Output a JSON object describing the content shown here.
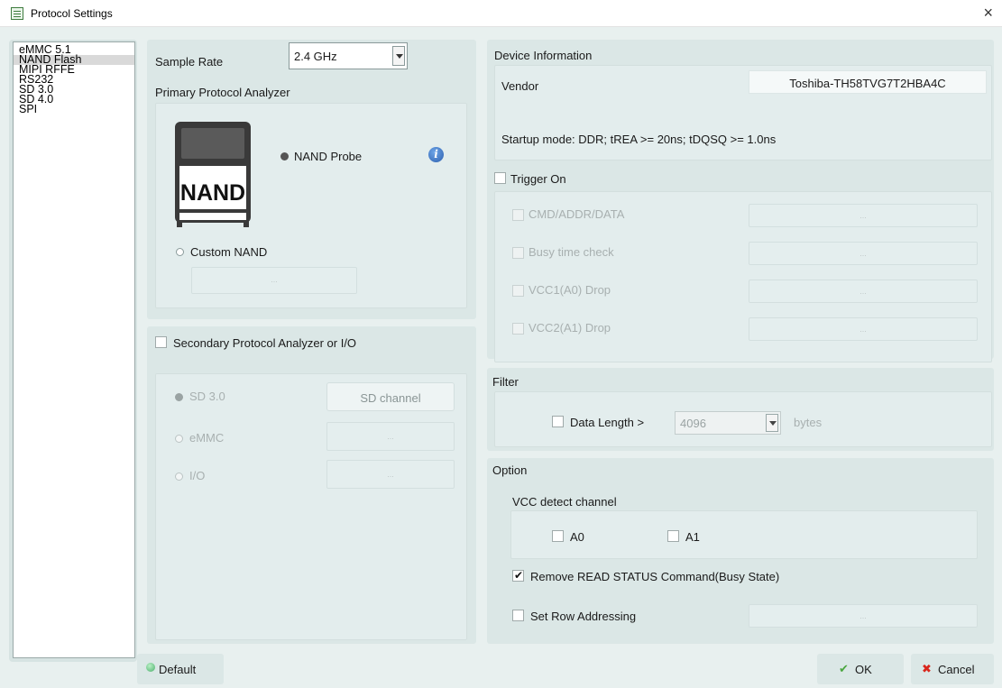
{
  "window": {
    "title": "Protocol Settings",
    "close": "×"
  },
  "protocols": {
    "items": [
      "eMMC 5.1",
      "NAND Flash",
      "MIPI RFFE",
      "RS232",
      "SD 3.0",
      "SD 4.0",
      "SPI"
    ],
    "selected": "NAND Flash"
  },
  "primary": {
    "sample_rate_label": "Sample Rate",
    "sample_rate_value": "2.4 GHz",
    "section_label": "Primary Protocol Analyzer",
    "chip_text": "NAND",
    "nand_probe_label": "NAND Probe",
    "custom_nand_label": "Custom NAND",
    "dots": "..."
  },
  "secondary": {
    "label": "Secondary Protocol Analyzer or I/O",
    "sd_label": "SD 3.0",
    "sd_channel": "SD channel",
    "emmc_label": "eMMC",
    "io_label": "I/O",
    "dots": "..."
  },
  "device": {
    "section_label": "Device Information",
    "vendor_label": "Vendor",
    "vendor_value": "Toshiba-TH58TVG7T2HBA4C",
    "startup_text": "Startup mode: DDR; tREA >= 20ns; tDQSQ >= 1.0ns"
  },
  "trigger": {
    "label": "Trigger On",
    "items": [
      "CMD/ADDR/DATA",
      "Busy time check",
      "VCC1(A0) Drop",
      "VCC2(A1) Drop"
    ],
    "dots": "..."
  },
  "filter": {
    "section_label": "Filter",
    "data_length_label": "Data Length >",
    "data_length_value": "4096",
    "unit": "bytes"
  },
  "option": {
    "section_label": "Option",
    "vcc_label": "VCC detect channel",
    "a0": "A0",
    "a1": "A1",
    "remove_read_status": "Remove READ STATUS Command(Busy State)",
    "remove_read_status_checked": true,
    "set_row_addressing": "Set Row Addressing",
    "dots": "..."
  },
  "buttons": {
    "default": "Default",
    "ok": "OK",
    "cancel": "Cancel",
    "ok_icon": "✔",
    "cancel_icon": "✖"
  },
  "colors": {
    "background": "#e8f0ef",
    "panel": "#dbe7e6",
    "ok_green": "#4aa63f",
    "cancel_red": "#d9261c"
  }
}
